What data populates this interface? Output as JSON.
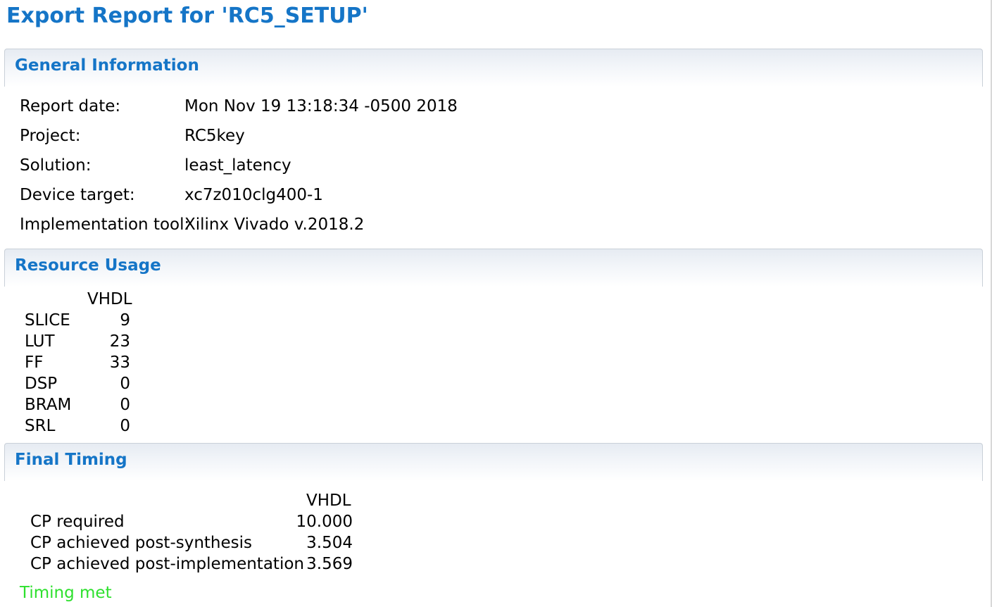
{
  "title": "Export Report for 'RC5_SETUP'",
  "general": {
    "header": "General Information",
    "rows": [
      {
        "label": "Report date:",
        "value": "Mon Nov 19 13:18:34 -0500 2018"
      },
      {
        "label": "Project:",
        "value": "RC5key"
      },
      {
        "label": "Solution:",
        "value": "least_latency"
      },
      {
        "label": "Device target:",
        "value": "xc7z010clg400-1"
      },
      {
        "label": "Implementation tool:",
        "value": "Xilinx Vivado v.2018.2"
      }
    ]
  },
  "resources": {
    "header": "Resource Usage",
    "column": "VHDL",
    "rows": [
      {
        "name": "SLICE",
        "value": "9"
      },
      {
        "name": "LUT",
        "value": "23"
      },
      {
        "name": "FF",
        "value": "33"
      },
      {
        "name": "DSP",
        "value": "0"
      },
      {
        "name": "BRAM",
        "value": "0"
      },
      {
        "name": "SRL",
        "value": "0"
      }
    ]
  },
  "timing": {
    "header": "Final Timing",
    "column": "VHDL",
    "rows": [
      {
        "name": "CP required",
        "value": "10.000"
      },
      {
        "name": "CP achieved post-synthesis",
        "value": "3.504"
      },
      {
        "name": "CP achieved post-implementation",
        "value": "3.569"
      }
    ],
    "status": "Timing met",
    "status_color": "#2ee02e"
  },
  "colors": {
    "title": "#1575c7",
    "header_text": "#1575c7"
  }
}
